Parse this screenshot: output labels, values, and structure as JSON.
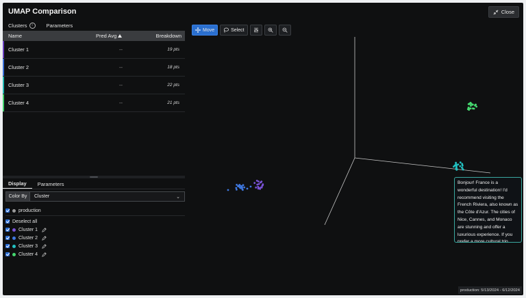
{
  "window": {
    "title": "UMAP Comparison",
    "close_label": "Close"
  },
  "top_tabs": [
    {
      "label": "Clusters",
      "has_info": true
    },
    {
      "label": "Parameters"
    }
  ],
  "table": {
    "columns": {
      "name": "Name",
      "pred": "Pred Avg",
      "breakdown": "Breakdown"
    },
    "rows": [
      {
        "name": "Cluster 1",
        "pred": "--",
        "breakdown": "19 pts",
        "color": "#6a3fbf"
      },
      {
        "name": "Cluster 2",
        "pred": "--",
        "breakdown": "18 pts",
        "color": "#3a6fd8"
      },
      {
        "name": "Cluster 3",
        "pred": "--",
        "breakdown": "22 pts",
        "color": "#1fb5b0"
      },
      {
        "name": "Cluster 4",
        "pred": "--",
        "breakdown": "21 pts",
        "color": "#3fcf6a"
      }
    ]
  },
  "bottom_tabs": [
    {
      "label": "Display",
      "active": true
    },
    {
      "label": "Parameters"
    }
  ],
  "color_by": {
    "label": "Color By",
    "value": "Cluster"
  },
  "legend": {
    "dataset": {
      "label": "production",
      "color": "#9a9a9a"
    },
    "deselect_label": "Deselect all",
    "clusters": [
      {
        "label": "Cluster 1",
        "color": "#7a52d6"
      },
      {
        "label": "Cluster 2",
        "color": "#3f78e0"
      },
      {
        "label": "Cluster 3",
        "color": "#22c1c1"
      },
      {
        "label": "Cluster 4",
        "color": "#45d86f"
      }
    ]
  },
  "toolbar": {
    "move_label": "Move",
    "select_label": "Select"
  },
  "tooltip_text": "Bonjour! France is a wonderful destination! I'd recommend visiting the French Riviera, also known as the Côte d'Azur. The cities of Nice, Cannes, and Monaco are stunning and offer a luxurious experience. If you prefer a more cultural trip, consider visiting Paris",
  "footer_text": "production: 5/13/2024 - 6/12/2024"
}
